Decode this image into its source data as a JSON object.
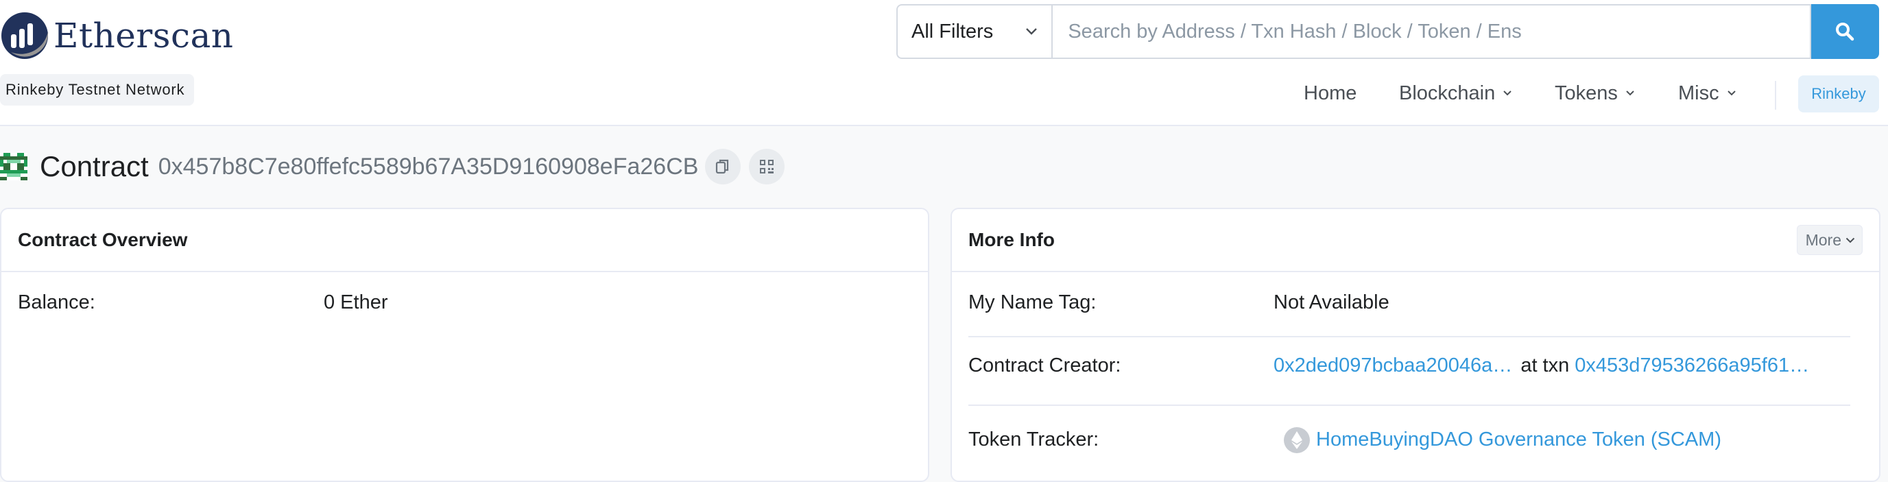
{
  "brand": {
    "name": "Etherscan",
    "network": "Rinkeby Testnet Network"
  },
  "search": {
    "filter_label": "All Filters",
    "placeholder": "Search by Address / Txn Hash / Block / Token / Ens"
  },
  "nav": {
    "home": "Home",
    "blockchain": "Blockchain",
    "tokens": "Tokens",
    "misc": "Misc",
    "network_button": "Rinkeby"
  },
  "page": {
    "title": "Contract",
    "address": "0x457b8C7e80ffefc5589b67A35D9160908eFa26CB"
  },
  "overview": {
    "title": "Contract Overview",
    "balance_label": "Balance:",
    "balance_value": "0 Ether"
  },
  "more_info": {
    "title": "More Info",
    "more_button": "More",
    "name_tag_label": "My Name Tag:",
    "name_tag_value": "Not Available",
    "creator_label": "Contract Creator:",
    "creator_address": "0x2ded097bcbaa20046a…",
    "at_txn": "at txn",
    "creator_txn": "0x453d79536266a95f61…",
    "token_tracker_label": "Token Tracker:",
    "token_tracker_value": "HomeBuyingDAO Governance Token (SCAM)"
  },
  "colors": {
    "brand_navy": "#21325b",
    "accent_blue": "#3498db",
    "border": "#e7eaf3",
    "page_bg": "#f8f9fa"
  },
  "icons": [
    "etherscan-logo",
    "chevron-down-icon",
    "search-icon",
    "copy-icon",
    "qr-code-icon",
    "ethereum-icon",
    "contract-avatar"
  ]
}
